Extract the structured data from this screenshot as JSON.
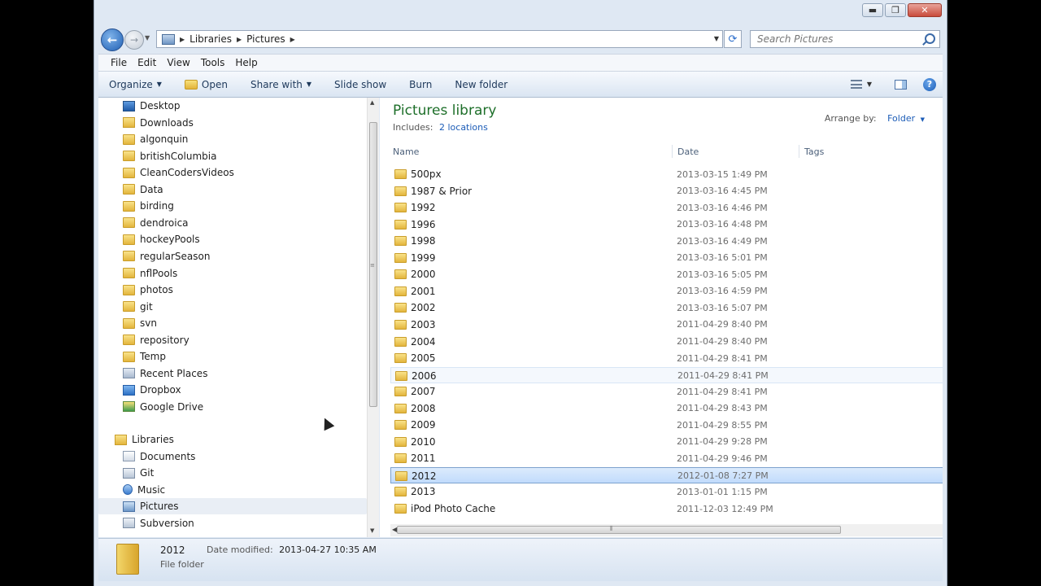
{
  "titlebar": {
    "minimize": "▬",
    "maximize": "❐",
    "close": "✕"
  },
  "address": {
    "crumbs": [
      "Libraries",
      "Pictures"
    ]
  },
  "search": {
    "placeholder": "Search Pictures"
  },
  "menu": [
    "File",
    "Edit",
    "View",
    "Tools",
    "Help"
  ],
  "toolbar": {
    "organize": "Organize",
    "open": "Open",
    "share_with": "Share with",
    "slide_show": "Slide show",
    "burn": "Burn",
    "new_folder": "New folder"
  },
  "nav": {
    "favorites": [
      {
        "label": "Desktop",
        "icon": "desktop-icon"
      },
      {
        "label": "Downloads",
        "icon": "downloads-icon"
      },
      {
        "label": "algonquin",
        "icon": "folder-icon"
      },
      {
        "label": "britishColumbia",
        "icon": "folder-icon"
      },
      {
        "label": "CleanCodersVideos",
        "icon": "folder-icon"
      },
      {
        "label": "Data",
        "icon": "folder-icon"
      },
      {
        "label": "birding",
        "icon": "folder-icon"
      },
      {
        "label": "dendroica",
        "icon": "folder-icon"
      },
      {
        "label": "hockeyPools",
        "icon": "folder-icon"
      },
      {
        "label": "regularSeason",
        "icon": "folder-icon"
      },
      {
        "label": "nflPools",
        "icon": "folder-icon"
      },
      {
        "label": "photos",
        "icon": "folder-icon"
      },
      {
        "label": "git",
        "icon": "folder-icon"
      },
      {
        "label": "svn",
        "icon": "folder-icon"
      },
      {
        "label": "repository",
        "icon": "folder-icon"
      },
      {
        "label": "Temp",
        "icon": "folder-icon"
      },
      {
        "label": "Recent Places",
        "icon": "recent-places-icon"
      },
      {
        "label": "Dropbox",
        "icon": "dropbox-icon"
      },
      {
        "label": "Google Drive",
        "icon": "google-drive-icon"
      }
    ],
    "libraries_label": "Libraries",
    "libraries": [
      {
        "label": "Documents",
        "icon": "documents-icon"
      },
      {
        "label": "Git",
        "icon": "git-library-icon"
      },
      {
        "label": "Music",
        "icon": "music-icon"
      },
      {
        "label": "Pictures",
        "icon": "pictures-icon"
      },
      {
        "label": "Subversion",
        "icon": "subversion-icon"
      }
    ]
  },
  "library": {
    "title": "Pictures library",
    "includes_label": "Includes:",
    "includes_link": "2 locations",
    "arrange_label": "Arrange by:",
    "arrange_value": "Folder"
  },
  "columns": {
    "name": "Name",
    "date": "Date",
    "tags": "Tags"
  },
  "files": [
    {
      "name": "500px",
      "date": "2013-03-15 1:49 PM"
    },
    {
      "name": "1987 & Prior",
      "date": "2013-03-16 4:45 PM"
    },
    {
      "name": "1992",
      "date": "2013-03-16 4:46 PM"
    },
    {
      "name": "1996",
      "date": "2013-03-16 4:48 PM"
    },
    {
      "name": "1998",
      "date": "2013-03-16 4:49 PM"
    },
    {
      "name": "1999",
      "date": "2013-03-16 5:01 PM"
    },
    {
      "name": "2000",
      "date": "2013-03-16 5:05 PM"
    },
    {
      "name": "2001",
      "date": "2013-03-16 4:59 PM"
    },
    {
      "name": "2002",
      "date": "2013-03-16 5:07 PM"
    },
    {
      "name": "2003",
      "date": "2011-04-29 8:40 PM"
    },
    {
      "name": "2004",
      "date": "2011-04-29 8:40 PM"
    },
    {
      "name": "2005",
      "date": "2011-04-29 8:41 PM"
    },
    {
      "name": "2006",
      "date": "2011-04-29 8:41 PM"
    },
    {
      "name": "2007",
      "date": "2011-04-29 8:41 PM"
    },
    {
      "name": "2008",
      "date": "2011-04-29 8:43 PM"
    },
    {
      "name": "2009",
      "date": "2011-04-29 8:55 PM"
    },
    {
      "name": "2010",
      "date": "2011-04-29 9:28 PM"
    },
    {
      "name": "2011",
      "date": "2011-04-29 9:46 PM"
    },
    {
      "name": "2012",
      "date": "2012-01-08 7:27 PM"
    },
    {
      "name": "2013",
      "date": "2013-01-01 1:15 PM"
    },
    {
      "name": "iPod Photo Cache",
      "date": "2011-12-03 12:49 PM"
    }
  ],
  "hover_file": "2006",
  "selected_file": "2012",
  "details": {
    "name": "2012",
    "type": "File folder",
    "modified_label": "Date modified:",
    "modified_value": "2013-04-27 10:35 AM"
  }
}
